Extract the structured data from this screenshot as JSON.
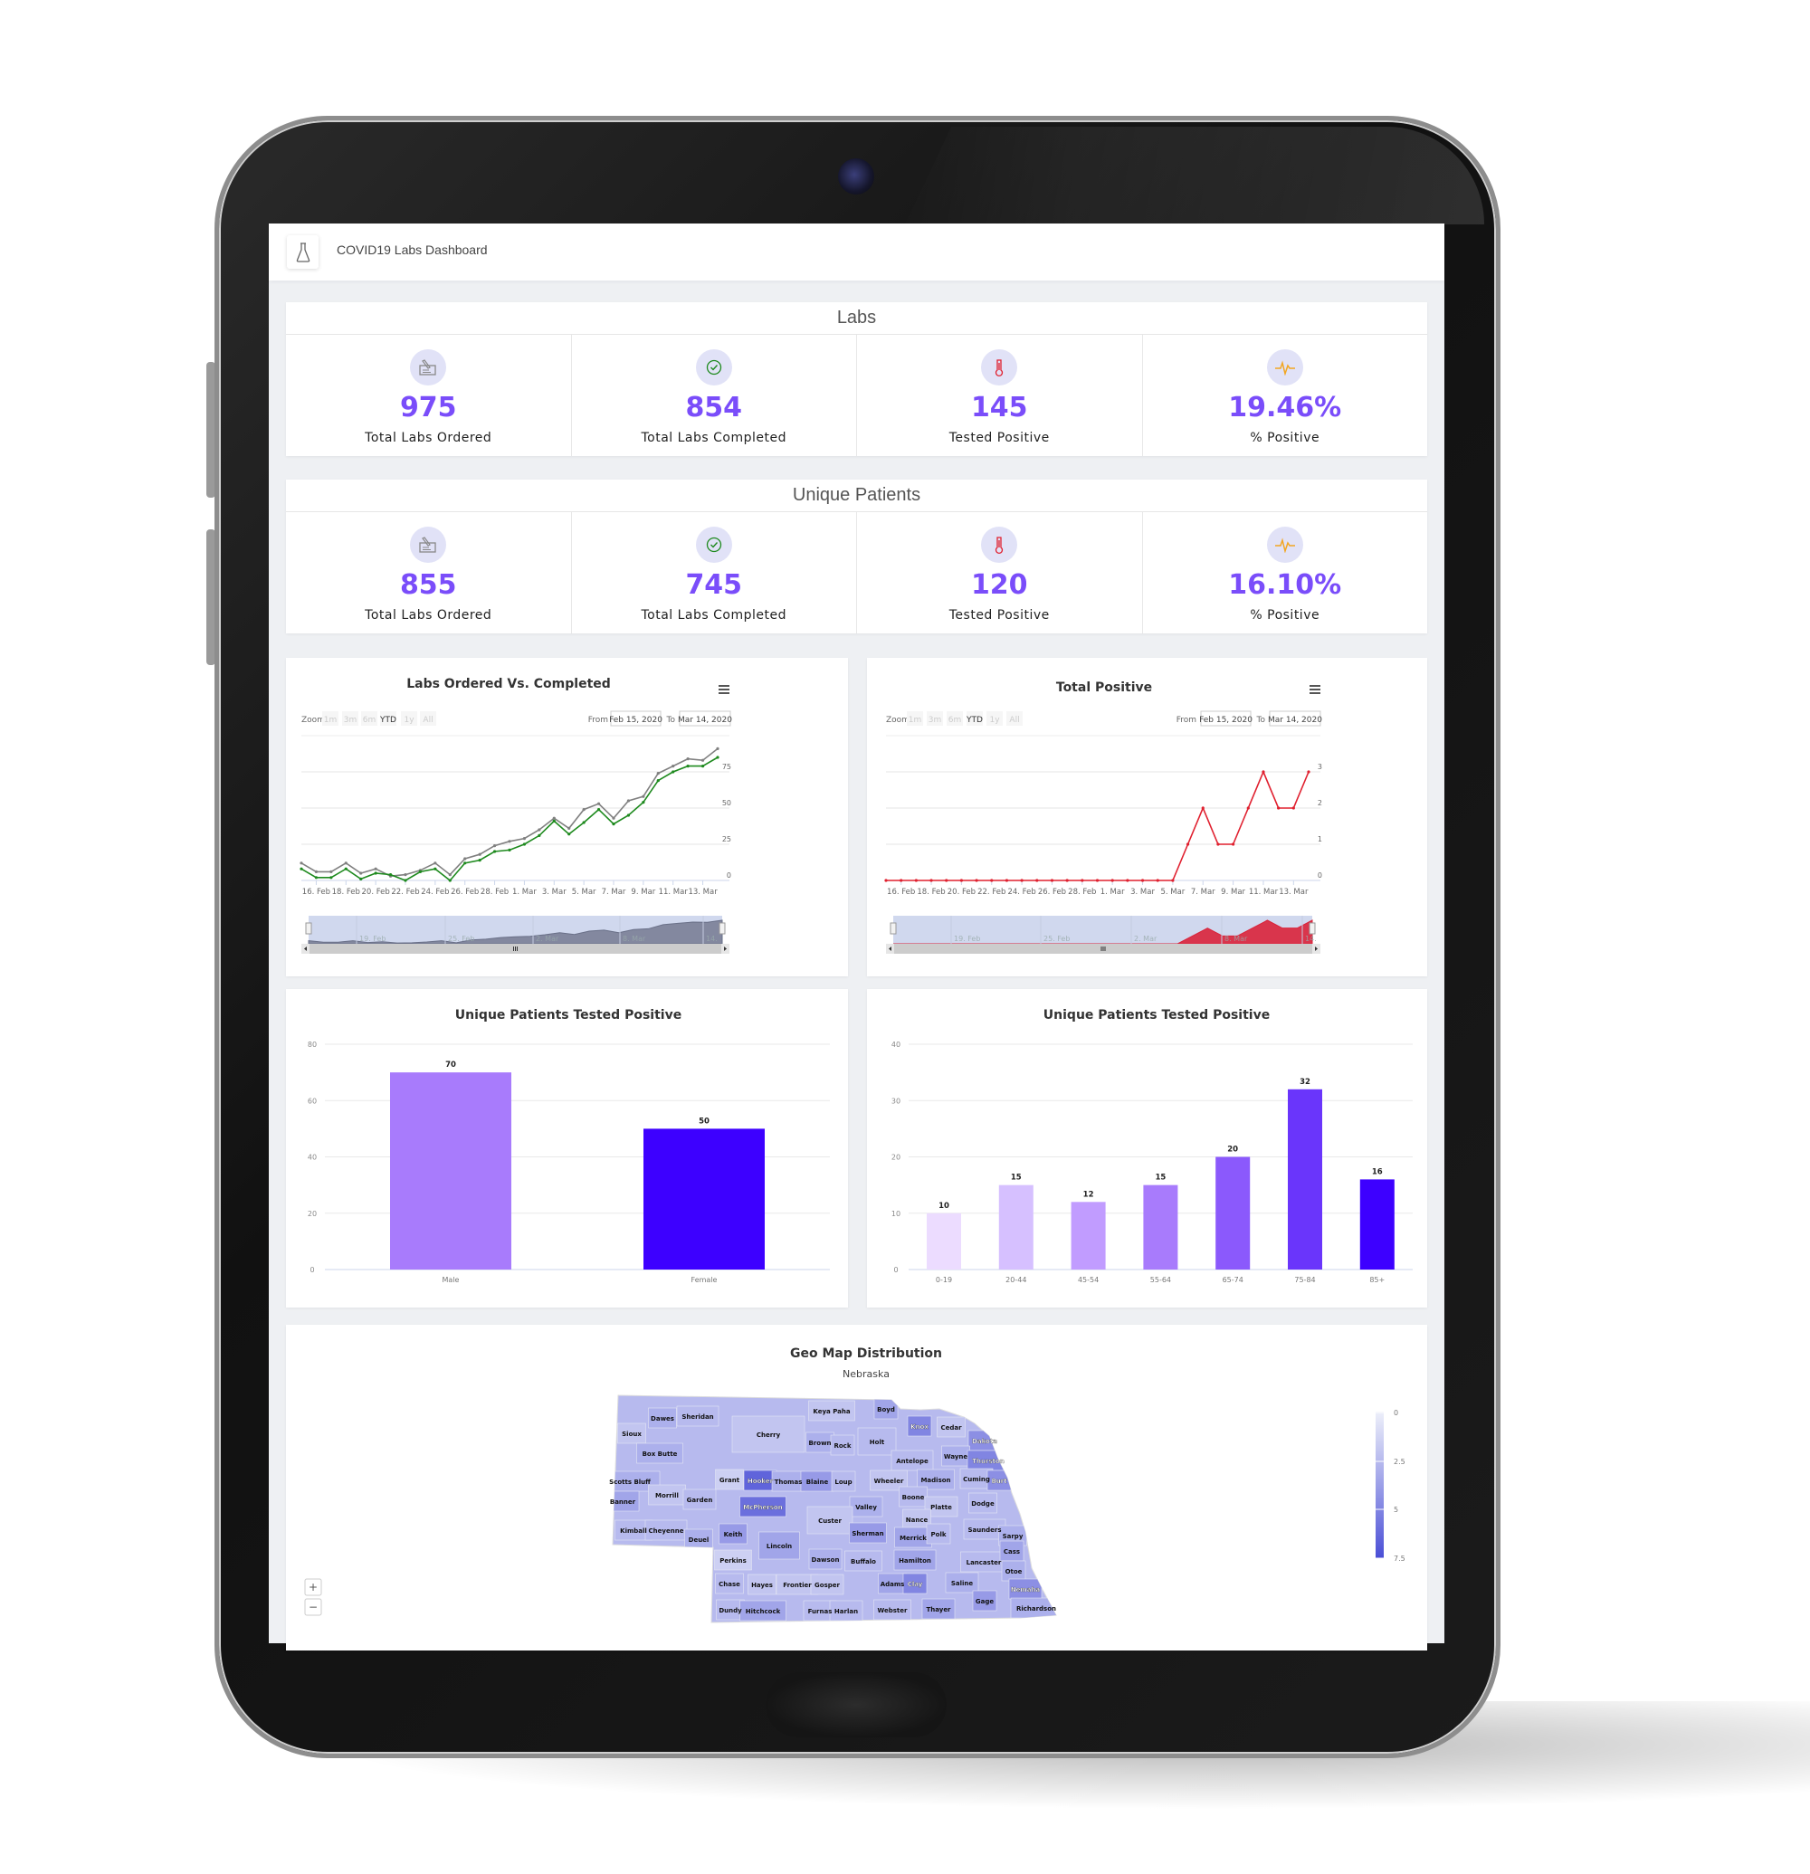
{
  "app": {
    "title": "COVID19 Labs Dashboard",
    "icon": "flask-icon"
  },
  "labs": {
    "title": "Labs",
    "kpis": [
      {
        "icon": "lab-order-icon",
        "value": "975",
        "label": "Total Labs Ordered"
      },
      {
        "icon": "check-circle-icon",
        "value": "854",
        "label": "Total Labs Completed"
      },
      {
        "icon": "thermometer-icon",
        "value": "145",
        "label": "Tested Positive"
      },
      {
        "icon": "pulse-icon",
        "value": "19.46%",
        "label": "% Positive"
      }
    ]
  },
  "unique_patients": {
    "title": "Unique Patients",
    "kpis": [
      {
        "icon": "lab-order-icon",
        "value": "855",
        "label": "Total Labs Ordered"
      },
      {
        "icon": "check-circle-icon",
        "value": "745",
        "label": "Total Labs Completed"
      },
      {
        "icon": "thermometer-icon",
        "value": "120",
        "label": "Tested Positive"
      },
      {
        "icon": "pulse-icon",
        "value": "16.10%",
        "label": "% Positive"
      }
    ]
  },
  "colors": {
    "accent": "#7a4dfa",
    "ordered": "#808080",
    "completed": "#1e8a1e",
    "positive": "#e0202f",
    "male": "#a87bfc",
    "female": "#3d00ff",
    "map_low": "#eef0fa",
    "map_high": "#4a4fd6"
  },
  "range_selector": {
    "zoom_label": "Zoom",
    "buttons": [
      "1m",
      "3m",
      "6m",
      "YTD",
      "1y",
      "All"
    ],
    "active": "YTD",
    "from_label": "From",
    "from_value": "Feb 15, 2020",
    "to_label": "To",
    "to_value": "Mar 14, 2020"
  },
  "chart_data": [
    {
      "id": "labs-ordered-vs-completed",
      "type": "line",
      "title": "Labs Ordered Vs. Completed",
      "x": [
        "2020-02-15",
        "2020-02-16",
        "2020-02-17",
        "2020-02-18",
        "2020-02-19",
        "2020-02-20",
        "2020-02-21",
        "2020-02-22",
        "2020-02-23",
        "2020-02-24",
        "2020-02-25",
        "2020-02-26",
        "2020-02-27",
        "2020-02-28",
        "2020-02-29",
        "2020-03-01",
        "2020-03-02",
        "2020-03-03",
        "2020-03-04",
        "2020-03-05",
        "2020-03-06",
        "2020-03-07",
        "2020-03-08",
        "2020-03-09",
        "2020-03-10",
        "2020-03-11",
        "2020-03-12",
        "2020-03-13",
        "2020-03-14"
      ],
      "series": [
        {
          "values": [
            12,
            6,
            6,
            12,
            5,
            8,
            3,
            4,
            7,
            12,
            4,
            15,
            18,
            24,
            27,
            29,
            35,
            43,
            36,
            49,
            53,
            43,
            55,
            58,
            74,
            79,
            84,
            83,
            91
          ]
        },
        {
          "values": [
            8,
            2,
            2,
            8,
            1,
            5,
            4,
            0,
            6,
            8,
            0,
            12,
            14,
            20,
            21,
            25,
            31,
            41,
            32,
            40,
            49,
            39,
            45,
            54,
            69,
            75,
            79,
            79,
            85
          ]
        }
      ],
      "xticks": [
        "16. Feb",
        "18. Feb",
        "20. Feb",
        "22. Feb",
        "24. Feb",
        "26. Feb",
        "28. Feb",
        "1. Mar",
        "3. Mar",
        "5. Mar",
        "7. Mar",
        "9. Mar",
        "11. Mar",
        "13. Mar"
      ],
      "yticks": [
        0,
        25,
        50,
        75
      ],
      "ylim": [
        0,
        100
      ],
      "grid": true,
      "navigator_labels": [
        "19. Feb",
        "25. Feb",
        "2. Mar",
        "8. Mar",
        "14."
      ]
    },
    {
      "id": "total-positive",
      "type": "line",
      "title": "Total Positive",
      "x": [
        "2020-02-15",
        "2020-02-16",
        "2020-02-17",
        "2020-02-18",
        "2020-02-19",
        "2020-02-20",
        "2020-02-21",
        "2020-02-22",
        "2020-02-23",
        "2020-02-24",
        "2020-02-25",
        "2020-02-26",
        "2020-02-27",
        "2020-02-28",
        "2020-02-29",
        "2020-03-01",
        "2020-03-02",
        "2020-03-03",
        "2020-03-04",
        "2020-03-05",
        "2020-03-06",
        "2020-03-07",
        "2020-03-08",
        "2020-03-09",
        "2020-03-10",
        "2020-03-11",
        "2020-03-12",
        "2020-03-13",
        "2020-03-14"
      ],
      "series": [
        {
          "values": [
            0,
            0,
            0,
            0,
            0,
            0,
            0,
            0,
            0,
            0,
            0,
            0,
            0,
            0,
            0,
            0,
            0,
            0,
            0,
            0,
            1,
            2,
            1,
            1,
            2,
            3,
            2,
            2,
            3
          ]
        }
      ],
      "xticks": [
        "16. Feb",
        "18. Feb",
        "20. Feb",
        "22. Feb",
        "24. Feb",
        "26. Feb",
        "28. Feb",
        "1. Mar",
        "3. Mar",
        "5. Mar",
        "7. Mar",
        "9. Mar",
        "11. Mar",
        "13. Mar"
      ],
      "yticks": [
        0,
        1,
        2,
        3
      ],
      "ylim": [
        0,
        4
      ],
      "grid": true,
      "navigator_labels": [
        "19. Feb",
        "25. Feb",
        "2. Mar",
        "8. Mar",
        "14."
      ]
    },
    {
      "id": "positive-by-gender",
      "type": "bar",
      "title": "Unique Patients Tested Positive",
      "categories": [
        "Male",
        "Female"
      ],
      "values": [
        70,
        50
      ],
      "colors": [
        "#a87bfc",
        "#3d00ff"
      ],
      "yticks": [
        0,
        20,
        40,
        60,
        80
      ],
      "ylim": [
        0,
        80
      ],
      "grid": true
    },
    {
      "id": "positive-by-age",
      "type": "bar",
      "title": "Unique Patients Tested Positive",
      "categories": [
        "0-19",
        "20-44",
        "45-54",
        "55-64",
        "65-74",
        "75-84",
        "85+"
      ],
      "values": [
        10,
        15,
        12,
        15,
        20,
        32,
        16
      ],
      "colors": [
        "#ecdcff",
        "#d6c0ff",
        "#c19cff",
        "#a87bfc",
        "#8b59fc",
        "#6a35fb",
        "#3d00ff"
      ],
      "yticks": [
        0,
        10,
        20,
        30,
        40
      ],
      "ylim": [
        0,
        40
      ],
      "grid": true
    },
    {
      "id": "geo-map",
      "type": "heatmap",
      "title": "Geo Map Distribution",
      "subtitle": "Nebraska",
      "legend_ticks": [
        "0",
        "2.5",
        "5",
        "7.5"
      ],
      "legend_range": [
        0,
        7.5
      ],
      "zoom_in": "+",
      "zoom_out": "−",
      "counties": [
        {
          "name": "Sioux",
          "value": 2
        },
        {
          "name": "Dawes",
          "value": 3
        },
        {
          "name": "Sheridan",
          "value": 2.5
        },
        {
          "name": "Box Butte",
          "value": 3
        },
        {
          "name": "Cherry",
          "value": 2
        },
        {
          "name": "Keya Paha",
          "value": 2
        },
        {
          "name": "Boyd",
          "value": 3.5
        },
        {
          "name": "Brown",
          "value": 3
        },
        {
          "name": "Rock",
          "value": 2.5
        },
        {
          "name": "Holt",
          "value": 2.5
        },
        {
          "name": "Knox",
          "value": 5
        },
        {
          "name": "Cedar",
          "value": 2
        },
        {
          "name": "Dakota",
          "value": 4.5
        },
        {
          "name": "Antelope",
          "value": 2.5
        },
        {
          "name": "Wayne",
          "value": 3
        },
        {
          "name": "Thurston",
          "value": 5
        },
        {
          "name": "Scotts Bluff",
          "value": 3
        },
        {
          "name": "Grant",
          "value": 1.5
        },
        {
          "name": "Hooker",
          "value": 6.5
        },
        {
          "name": "Thomas",
          "value": 3
        },
        {
          "name": "Blaine",
          "value": 4
        },
        {
          "name": "Loup",
          "value": 2.5
        },
        {
          "name": "Wheeler",
          "value": 2
        },
        {
          "name": "Madison",
          "value": 3
        },
        {
          "name": "Cuming",
          "value": 2.5
        },
        {
          "name": "Burt",
          "value": 4.5
        },
        {
          "name": "Banner",
          "value": 3.5
        },
        {
          "name": "Morrill",
          "value": 2
        },
        {
          "name": "Garden",
          "value": 2.5
        },
        {
          "name": "McPherson",
          "value": 6
        },
        {
          "name": "Boone",
          "value": 2.5
        },
        {
          "name": "Platte",
          "value": 2
        },
        {
          "name": "Dodge",
          "value": 2.5
        },
        {
          "name": "Valley",
          "value": 3
        },
        {
          "name": "Custer",
          "value": 2
        },
        {
          "name": "Nance",
          "value": 2
        },
        {
          "name": "Kimball",
          "value": 2.5
        },
        {
          "name": "Cheyenne",
          "value": 2.5
        },
        {
          "name": "Deuel",
          "value": 3
        },
        {
          "name": "Keith",
          "value": 4
        },
        {
          "name": "Sherman",
          "value": 4
        },
        {
          "name": "Merrick",
          "value": 3.5
        },
        {
          "name": "Polk",
          "value": 2.5
        },
        {
          "name": "Saunders",
          "value": 2.5
        },
        {
          "name": "Sarpy",
          "value": 3
        },
        {
          "name": "Lincoln",
          "value": 3.5
        },
        {
          "name": "Perkins",
          "value": 1.5
        },
        {
          "name": "Dawson",
          "value": 3
        },
        {
          "name": "Buffalo",
          "value": 2.5
        },
        {
          "name": "Hamilton",
          "value": 3.5
        },
        {
          "name": "Lancaster",
          "value": 2.5
        },
        {
          "name": "Cass",
          "value": 3.5
        },
        {
          "name": "Otoe",
          "value": 3
        },
        {
          "name": "Chase",
          "value": 2.5
        },
        {
          "name": "Hayes",
          "value": 2
        },
        {
          "name": "Frontier",
          "value": 2
        },
        {
          "name": "Gosper",
          "value": 2
        },
        {
          "name": "Adams",
          "value": 3.5
        },
        {
          "name": "Clay",
          "value": 5
        },
        {
          "name": "Saline",
          "value": 3
        },
        {
          "name": "Nemaha",
          "value": 4.5
        },
        {
          "name": "Gage",
          "value": 4
        },
        {
          "name": "Dundy",
          "value": 2.5
        },
        {
          "name": "Hitchcock",
          "value": 3.5
        },
        {
          "name": "Furnas",
          "value": 2.5
        },
        {
          "name": "Harlan",
          "value": 2.5
        },
        {
          "name": "Webster",
          "value": 2.5
        },
        {
          "name": "Thayer",
          "value": 3.5
        },
        {
          "name": "Richardson",
          "value": 3
        }
      ]
    }
  ]
}
